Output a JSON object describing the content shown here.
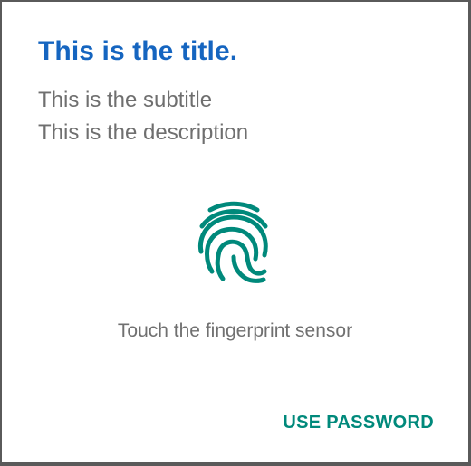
{
  "dialog": {
    "title": "This is the title.",
    "subtitle": "This is the subtitle",
    "description": "This is the description",
    "hint": "Touch the fingerprint sensor",
    "password_button_label": "USE PASSWORD",
    "icon": "fingerprint-icon"
  },
  "colors": {
    "title": "#1565c0",
    "accent": "#00897b",
    "body_text": "#6f6f6f"
  }
}
